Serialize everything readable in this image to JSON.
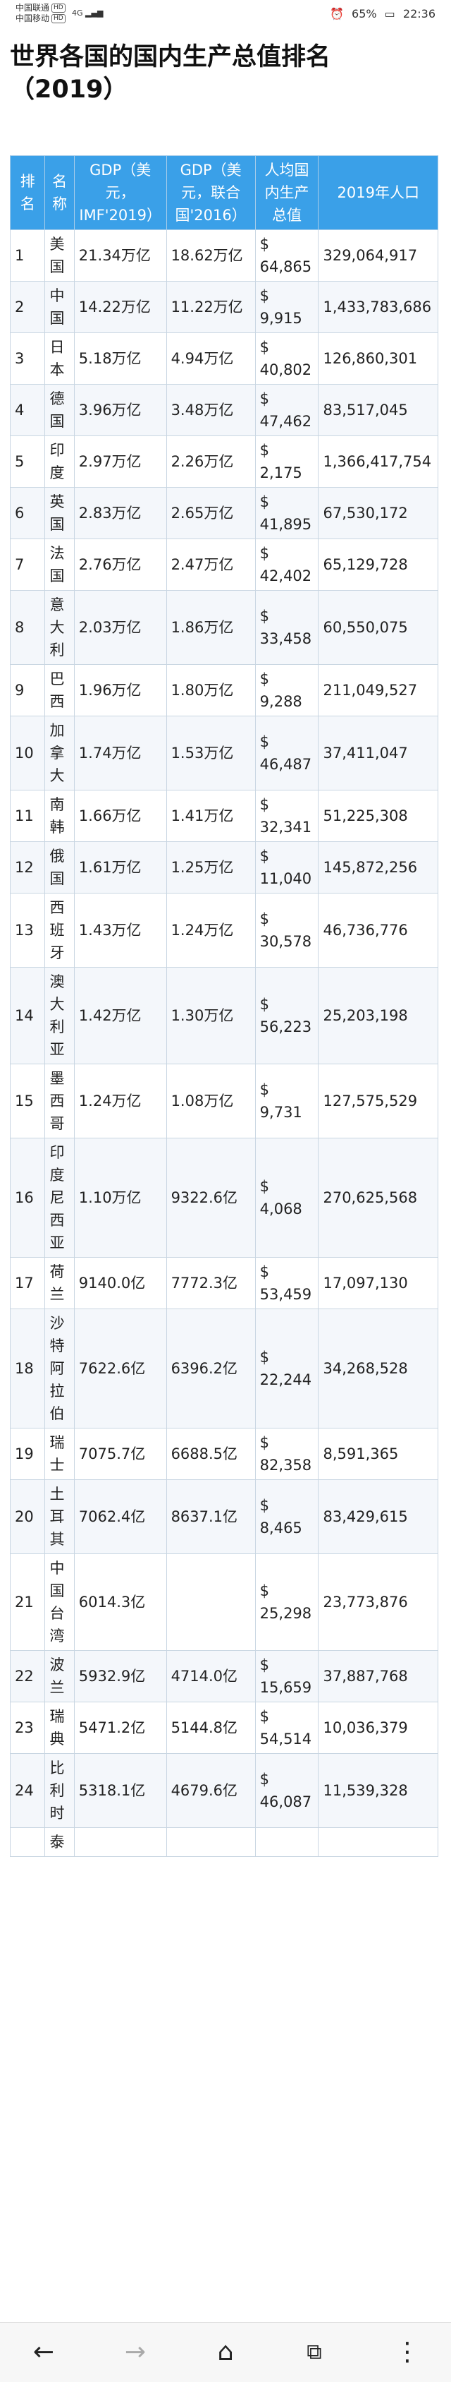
{
  "status": {
    "carrier1": "中国联通",
    "carrier1_tag": "HD",
    "carrier2": "中国移动",
    "carrier2_tag": "HD",
    "network": "4G",
    "battery": "65%",
    "time": "22:36"
  },
  "title": "世界各国的国内生产总值排名（2019）",
  "table": {
    "headers": [
      "排名",
      "名称",
      "GDP（美元，IMF'2019）",
      "GDP（美元，联合国'2016）",
      "人均国内生产总值",
      "2019年人口"
    ],
    "rows": [
      {
        "rank": "1",
        "name": "美国",
        "imf": "21.34万亿",
        "un": "18.62万亿",
        "pc": "$ 64,865",
        "pop": "329,064,917"
      },
      {
        "rank": "2",
        "name": "中国",
        "imf": "14.22万亿",
        "un": "11.22万亿",
        "pc": "$ 9,915",
        "pop": "1,433,783,686"
      },
      {
        "rank": "3",
        "name": "日本",
        "imf": "5.18万亿",
        "un": "4.94万亿",
        "pc": "$ 40,802",
        "pop": "126,860,301"
      },
      {
        "rank": "4",
        "name": "德国",
        "imf": "3.96万亿",
        "un": "3.48万亿",
        "pc": "$ 47,462",
        "pop": "83,517,045"
      },
      {
        "rank": "5",
        "name": "印度",
        "imf": "2.97万亿",
        "un": "2.26万亿",
        "pc": "$ 2,175",
        "pop": "1,366,417,754"
      },
      {
        "rank": "6",
        "name": "英国",
        "imf": "2.83万亿",
        "un": "2.65万亿",
        "pc": "$ 41,895",
        "pop": "67,530,172"
      },
      {
        "rank": "7",
        "name": "法国",
        "imf": "2.76万亿",
        "un": "2.47万亿",
        "pc": "$ 42,402",
        "pop": "65,129,728"
      },
      {
        "rank": "8",
        "name": "意大利",
        "imf": "2.03万亿",
        "un": "1.86万亿",
        "pc": "$ 33,458",
        "pop": "60,550,075"
      },
      {
        "rank": "9",
        "name": "巴西",
        "imf": "1.96万亿",
        "un": "1.80万亿",
        "pc": "$ 9,288",
        "pop": "211,049,527"
      },
      {
        "rank": "10",
        "name": "加拿大",
        "imf": "1.74万亿",
        "un": "1.53万亿",
        "pc": "$ 46,487",
        "pop": "37,411,047"
      },
      {
        "rank": "11",
        "name": "南韩",
        "imf": "1.66万亿",
        "un": "1.41万亿",
        "pc": "$ 32,341",
        "pop": "51,225,308"
      },
      {
        "rank": "12",
        "name": "俄国",
        "imf": "1.61万亿",
        "un": "1.25万亿",
        "pc": "$ 11,040",
        "pop": "145,872,256"
      },
      {
        "rank": "13",
        "name": "西班牙",
        "imf": "1.43万亿",
        "un": "1.24万亿",
        "pc": "$ 30,578",
        "pop": "46,736,776"
      },
      {
        "rank": "14",
        "name": "澳大利亚",
        "imf": "1.42万亿",
        "un": "1.30万亿",
        "pc": "$ 56,223",
        "pop": "25,203,198"
      },
      {
        "rank": "15",
        "name": "墨西哥",
        "imf": "1.24万亿",
        "un": "1.08万亿",
        "pc": "$ 9,731",
        "pop": "127,575,529"
      },
      {
        "rank": "16",
        "name": "印度尼西亚",
        "imf": "1.10万亿",
        "un": "9322.6亿",
        "pc": "$ 4,068",
        "pop": "270,625,568"
      },
      {
        "rank": "17",
        "name": "荷兰",
        "imf": "9140.0亿",
        "un": "7772.3亿",
        "pc": "$ 53,459",
        "pop": "17,097,130"
      },
      {
        "rank": "18",
        "name": "沙特阿拉伯",
        "imf": "7622.6亿",
        "un": "6396.2亿",
        "pc": "$ 22,244",
        "pop": "34,268,528"
      },
      {
        "rank": "19",
        "name": "瑞士",
        "imf": "7075.7亿",
        "un": "6688.5亿",
        "pc": "$ 82,358",
        "pop": "8,591,365"
      },
      {
        "rank": "20",
        "name": "土耳其",
        "imf": "7062.4亿",
        "un": "8637.1亿",
        "pc": "$ 8,465",
        "pop": "83,429,615"
      },
      {
        "rank": "21",
        "name": "中国台湾",
        "imf": "6014.3亿",
        "un": "",
        "pc": "$ 25,298",
        "pop": "23,773,876"
      },
      {
        "rank": "22",
        "name": "波兰",
        "imf": "5932.9亿",
        "un": "4714.0亿",
        "pc": "$ 15,659",
        "pop": "37,887,768"
      },
      {
        "rank": "23",
        "name": "瑞典",
        "imf": "5471.2亿",
        "un": "5144.8亿",
        "pc": "$ 54,514",
        "pop": "10,036,379"
      },
      {
        "rank": "24",
        "name": "比利时",
        "imf": "5318.1亿",
        "un": "4679.6亿",
        "pc": "$ 46,087",
        "pop": "11,539,328"
      },
      {
        "rank": "",
        "name": "泰",
        "imf": "",
        "un": "",
        "pc": "",
        "pop": ""
      }
    ]
  },
  "navbar": {
    "back_icon": "arrow-left-icon",
    "forward_icon": "arrow-right-icon",
    "home_icon": "home-icon",
    "tabs_icon": "tabs-icon",
    "menu_icon": "more-vertical-icon"
  }
}
